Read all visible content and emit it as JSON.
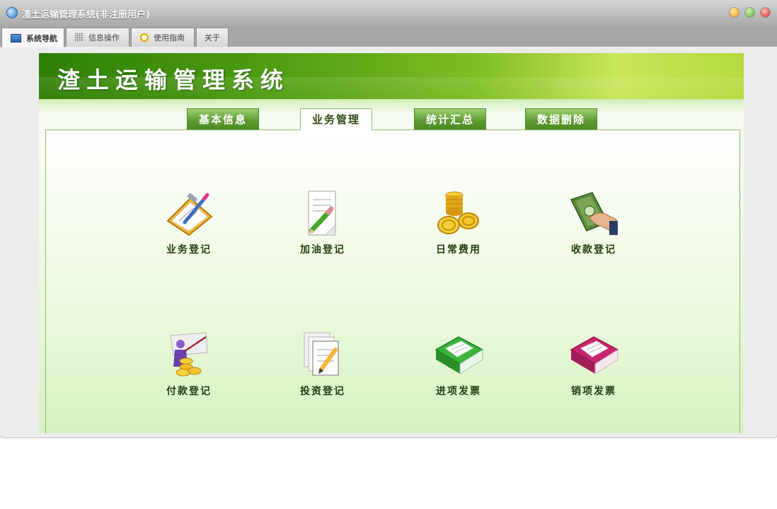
{
  "window": {
    "title": "渣土运输管理系统(非注册用户)"
  },
  "tabs": [
    {
      "label": "系统导航",
      "icon": "monitor-icon",
      "active": true
    },
    {
      "label": "信息操作",
      "icon": "grid-icon",
      "active": false
    },
    {
      "label": "使用指南",
      "icon": "guide-icon",
      "active": false
    },
    {
      "label": "关于",
      "active": false
    }
  ],
  "banner": {
    "title": "渣土运输管理系统"
  },
  "nav_tabs": [
    {
      "label": "基本信息",
      "active": false
    },
    {
      "label": "业务管理",
      "active": true
    },
    {
      "label": "统计汇总",
      "active": false
    },
    {
      "label": "数据删除",
      "active": false
    }
  ],
  "items": [
    {
      "label": "业务登记",
      "icon": "clipboard-pen-icon"
    },
    {
      "label": "加油登记",
      "icon": "document-pencil-icon"
    },
    {
      "label": "日常费用",
      "icon": "coins-icon"
    },
    {
      "label": "收款登记",
      "icon": "money-hand-icon"
    },
    {
      "label": "付款登记",
      "icon": "person-coins-icon"
    },
    {
      "label": "投资登记",
      "icon": "papers-pencil-icon"
    },
    {
      "label": "进项发票",
      "icon": "green-book-icon"
    },
    {
      "label": "销项发票",
      "icon": "red-book-icon"
    }
  ],
  "colors": {
    "accent_green": "#5f9d33",
    "title_green": "#1f3d0c"
  }
}
